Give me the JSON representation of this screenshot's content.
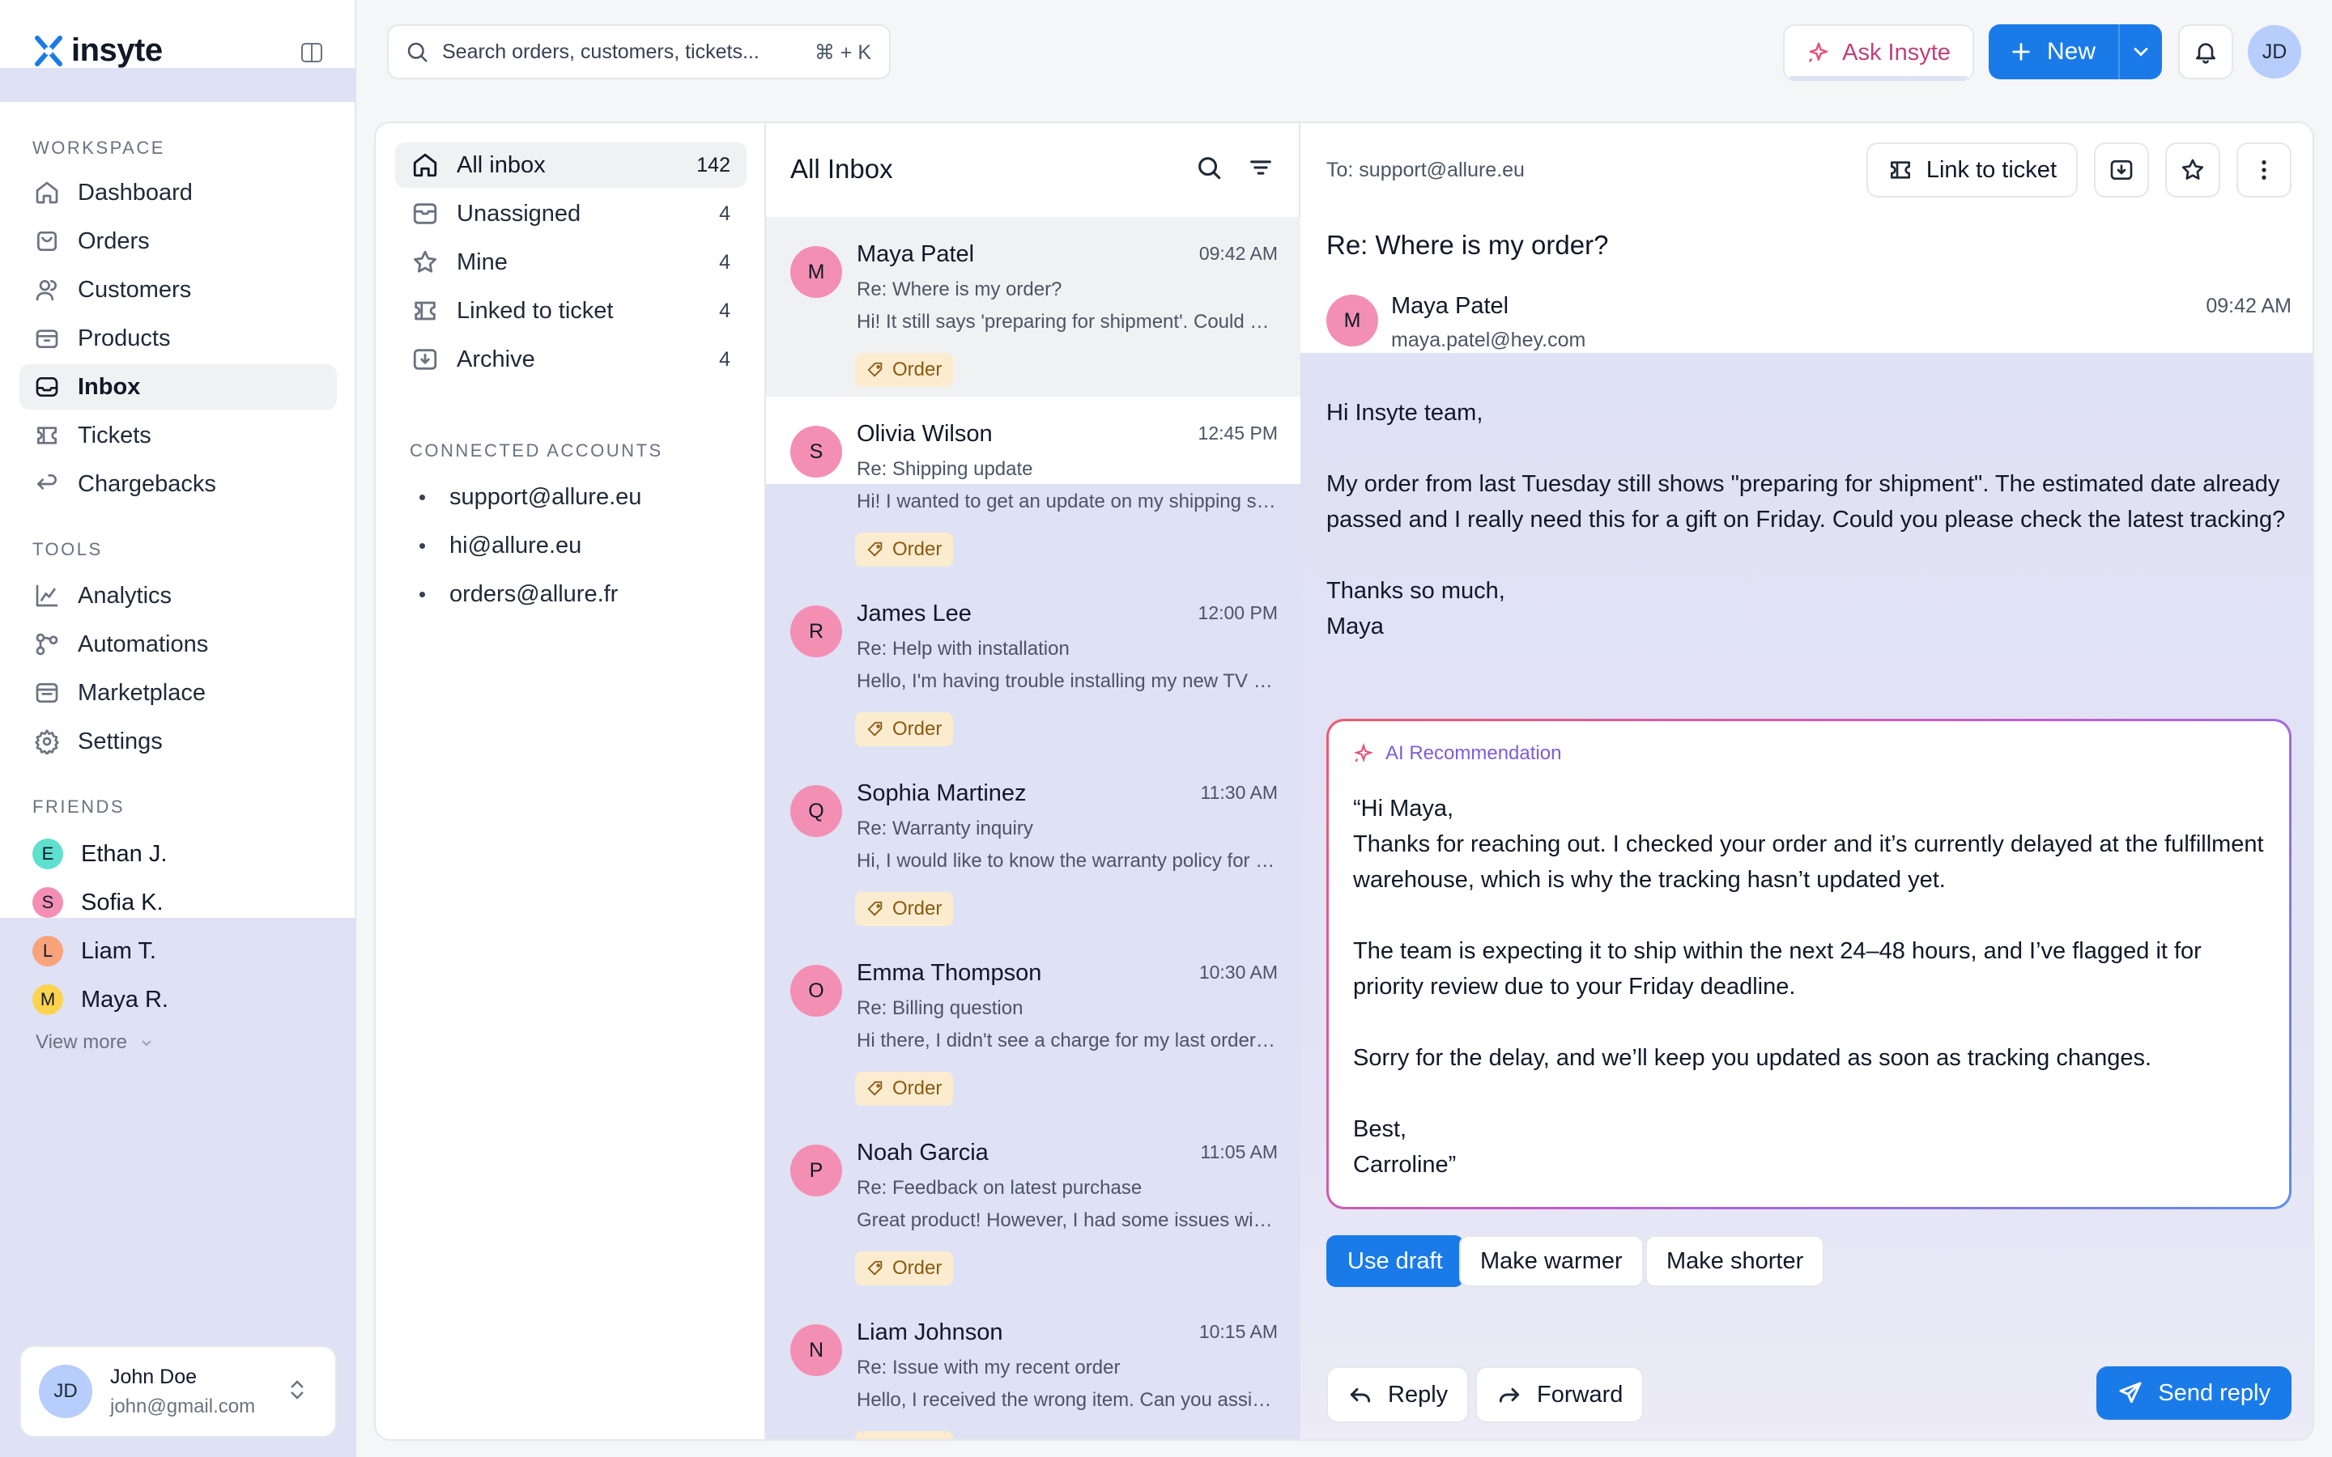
{
  "app": {
    "name": "insyte"
  },
  "sidebar": {
    "workspace_title": "WORKSPACE",
    "workspace_items": [
      {
        "label": "Dashboard",
        "icon": "home-icon"
      },
      {
        "label": "Orders",
        "icon": "orders-icon"
      },
      {
        "label": "Customers",
        "icon": "users-icon"
      },
      {
        "label": "Products",
        "icon": "box-icon"
      },
      {
        "label": "Inbox",
        "icon": "inbox-icon",
        "active": true
      },
      {
        "label": "Tickets",
        "icon": "ticket-icon"
      },
      {
        "label": "Chargebacks",
        "icon": "return-icon"
      }
    ],
    "tools_title": "TOOLS",
    "tools_items": [
      {
        "label": "Analytics",
        "icon": "chart-icon"
      },
      {
        "label": "Automations",
        "icon": "workflow-icon"
      },
      {
        "label": "Marketplace",
        "icon": "store-icon"
      },
      {
        "label": "Settings",
        "icon": "gear-icon"
      }
    ],
    "friends_title": "FRIENDS",
    "friends": [
      {
        "initial": "E",
        "name": "Ethan J.",
        "color": "#5ee0cf"
      },
      {
        "initial": "S",
        "name": "Sofia K.",
        "color": "#f38fb3"
      },
      {
        "initial": "L",
        "name": "Liam T.",
        "color": "#f9a37d"
      },
      {
        "initial": "M",
        "name": "Maya R.",
        "color": "#fcd34d"
      }
    ],
    "view_more": "View more",
    "user": {
      "initials": "JD",
      "name": "John Doe",
      "email": "john@gmail.com"
    }
  },
  "topbar": {
    "search_placeholder": "Search orders, customers, tickets...",
    "search_shortcut": "⌘ + K",
    "ask_label": "Ask Insyte",
    "new_label": "New",
    "avatar_initials": "JD"
  },
  "folders": {
    "items": [
      {
        "label": "All inbox",
        "count": "142",
        "icon": "home-icon",
        "active": true
      },
      {
        "label": "Unassigned",
        "count": "4",
        "icon": "unassigned-icon"
      },
      {
        "label": "Mine",
        "count": "4",
        "icon": "star-icon"
      },
      {
        "label": "Linked to ticket",
        "count": "4",
        "icon": "ticket-icon"
      },
      {
        "label": "Archive",
        "count": "4",
        "icon": "archive-icon"
      }
    ],
    "accounts_title": "CONNECTED ACCOUNTS",
    "accounts": [
      "support@allure.eu",
      "hi@allure.eu",
      "orders@allure.fr"
    ]
  },
  "list": {
    "title": "All Inbox",
    "tag_label": "Order",
    "messages": [
      {
        "initial": "M",
        "name": "Maya Patel",
        "time": "09:42 AM",
        "subject": "Re: Where is my order?",
        "preview": "Hi! It still says 'preparing for shipment'. Could you check on this?"
      },
      {
        "initial": "S",
        "name": "Olivia Wilson",
        "time": "12:45 PM",
        "subject": "Re: Shipping update",
        "preview": "Hi! I wanted to get an update on my shipping status please."
      },
      {
        "initial": "R",
        "name": "James Lee",
        "time": "12:00 PM",
        "subject": "Re: Help with installation",
        "preview": "Hello, I'm having trouble installing my new TV mount."
      },
      {
        "initial": "Q",
        "name": "Sophia Martinez",
        "time": "11:30 AM",
        "subject": "Re: Warranty inquiry",
        "preview": "Hi, I would like to know the warranty policy for my product."
      },
      {
        "initial": "O",
        "name": "Emma Thompson",
        "time": "10:30 AM",
        "subject": "Re: Billing question",
        "preview": "Hi there, I didn't see a charge for my last order yet."
      },
      {
        "initial": "P",
        "name": "Noah Garcia",
        "time": "11:05 AM",
        "subject": "Re: Feedback on latest purchase",
        "preview": "Great product! However, I had some issues with the setup."
      },
      {
        "initial": "N",
        "name": "Liam Johnson",
        "time": "10:15 AM",
        "subject": "Re: Issue with my recent order",
        "preview": "Hello, I received the wrong item. Can you assist me please?"
      }
    ]
  },
  "reader": {
    "to": "To: support@allure.eu",
    "link_ticket": "Link to ticket",
    "subject": "Re: Where is my order?",
    "sender_initial": "M",
    "sender_name": "Maya Patel",
    "sender_email": "maya.patel@hey.com",
    "time": "09:42 AM",
    "body": [
      "Hi Insyte team,",
      "My order from last Tuesday still shows \"preparing for shipment\". The estimated date already passed and I really need this for a gift on Friday. Could you please check the latest tracking?",
      "Thanks so much,\nMaya"
    ],
    "ai_label": "AI Recommendation",
    "ai_body": [
      "“Hi Maya,\nThanks for reaching out. I checked your order and it’s currently delayed at the fulfillment warehouse, which is why the tracking hasn’t updated yet.",
      "The team is expecting it to ship within the next 24–48 hours, and I’ve flagged it for priority review due to your Friday deadline.",
      "Sorry for the delay, and we’ll keep you updated as soon as tracking changes.",
      "Best,\nCarroline”"
    ],
    "chips": [
      "Use draft",
      "Make warmer",
      "Make shorter"
    ],
    "reply": "Reply",
    "forward": "Forward",
    "send": "Send reply"
  },
  "colors": {
    "accent": "#1a7be8",
    "tag_bg": "#fbeccf",
    "highlight": "#dfe1f4"
  }
}
